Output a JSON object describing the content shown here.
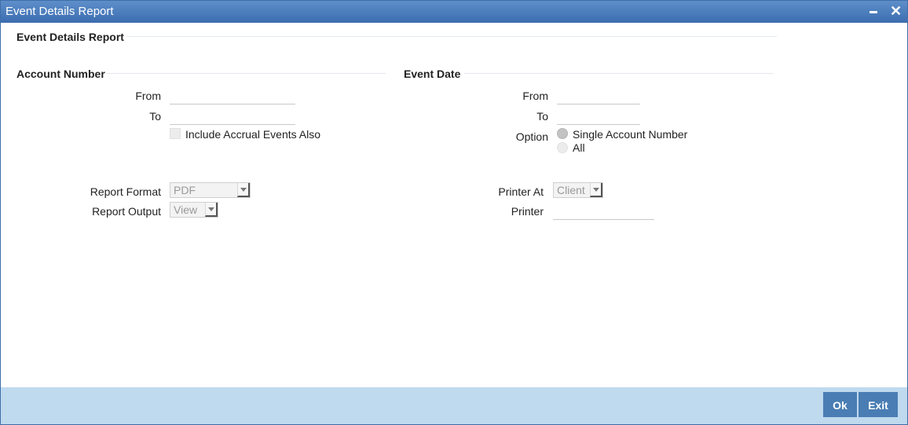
{
  "window": {
    "title": "Event Details Report"
  },
  "form": {
    "title": "Event Details Report"
  },
  "account": {
    "title": "Account Number",
    "from_label": "From",
    "from_value": "",
    "to_label": "To",
    "to_value": "",
    "include_accrual_label": "Include Accrual Events Also",
    "include_accrual_checked": false
  },
  "event_date": {
    "title": "Event Date",
    "from_label": "From",
    "from_value": "",
    "to_label": "To",
    "to_value": "",
    "option_label": "Option",
    "options": [
      {
        "label": "Single Account Number",
        "selected": true
      },
      {
        "label": "All",
        "selected": false
      }
    ]
  },
  "report": {
    "format_label": "Report Format",
    "format_value": "PDF",
    "output_label": "Report Output",
    "output_value": "View",
    "printer_at_label": "Printer At",
    "printer_at_value": "Client",
    "printer_label": "Printer",
    "printer_value": ""
  },
  "footer": {
    "ok_label": "Ok",
    "exit_label": "Exit"
  },
  "colors": {
    "titlebar": "#3b6db0",
    "footer": "#bfd9ee",
    "button": "#4a7db3"
  }
}
